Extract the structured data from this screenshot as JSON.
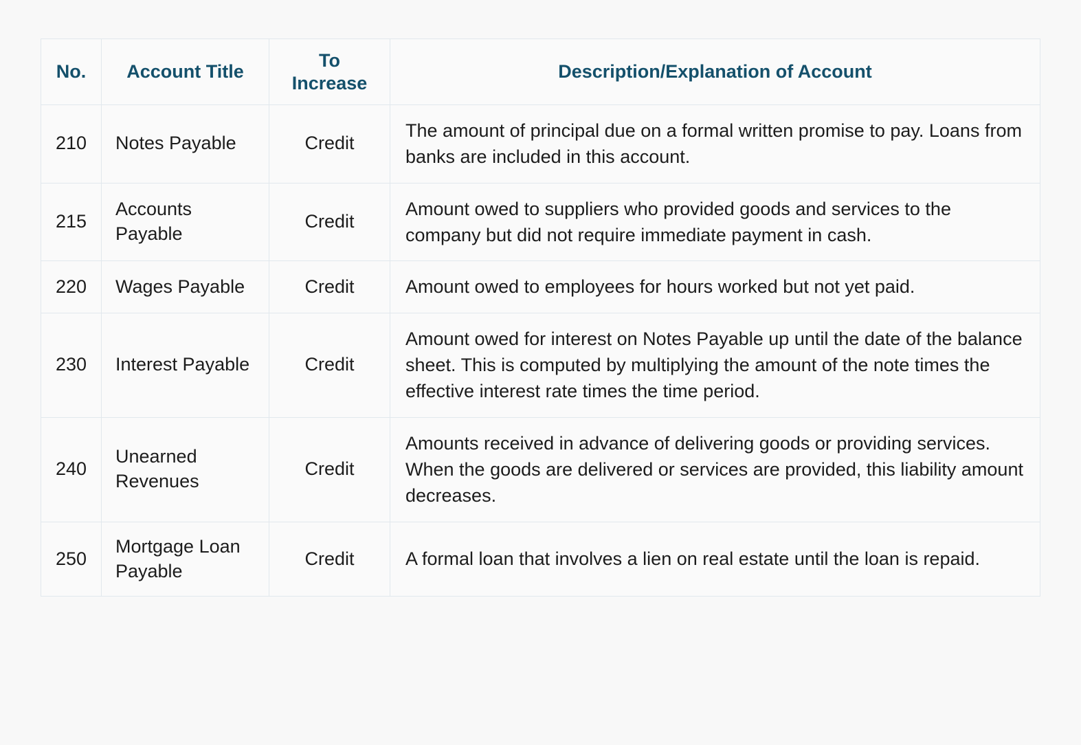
{
  "table": {
    "columns": [
      {
        "key": "no",
        "label": "No."
      },
      {
        "key": "title",
        "label": "Account Title"
      },
      {
        "key": "increase",
        "label_line1": "To",
        "label_line2": "Increase",
        "label": "To Increase"
      },
      {
        "key": "description",
        "label": "Description/Explanation of Account"
      }
    ],
    "rows": [
      {
        "no": "210",
        "title": "Notes Payable",
        "increase": "Credit",
        "description": "The amount of principal due on a formal written promise to pay. Loans from banks are included in this account."
      },
      {
        "no": "215",
        "title": "Accounts Payable",
        "increase": "Credit",
        "description": "Amount owed to suppliers who provided goods and services to the company but did not require immediate payment in cash."
      },
      {
        "no": "220",
        "title": "Wages Payable",
        "increase": "Credit",
        "description": "Amount owed to employees for hours worked but not yet paid."
      },
      {
        "no": "230",
        "title": "Interest Payable",
        "increase": "Credit",
        "description": "Amount owed for interest on Notes Payable up until the date of the balance sheet. This is computed by multiplying the amount of the note times the effective interest rate times the time period."
      },
      {
        "no": "240",
        "title": "Unearned Revenues",
        "increase": "Credit",
        "description": "Amounts received in advance of delivering goods or providing services. When the goods are delivered or services are provided, this liability amount decreases."
      },
      {
        "no": "250",
        "title": "Mortgage Loan Payable",
        "increase": "Credit",
        "description": "A formal loan that involves a lien on real estate until the loan is repaid."
      }
    ]
  },
  "colors": {
    "header_text": "#14506b",
    "body_text": "#1c1c1c",
    "border": "#e1e8ed",
    "cell_background": "#fafafa",
    "page_background": "#f8f8f8"
  }
}
